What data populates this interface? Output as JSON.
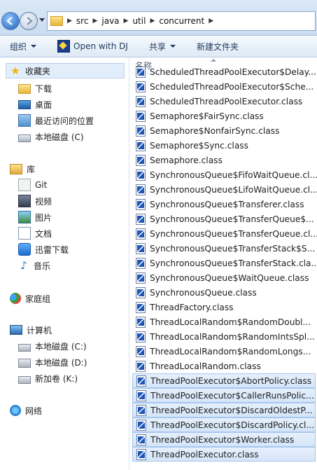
{
  "address": {
    "crumbs": [
      "src",
      "java",
      "util",
      "concurrent"
    ]
  },
  "toolbar": {
    "organize": "组织",
    "open_with": "Open with DJ",
    "share": "共享",
    "new_folder": "新建文件夹"
  },
  "nav": {
    "favorites": {
      "label": "收藏夹",
      "items": [
        "下载",
        "桌面",
        "最近访问的位置",
        "本地磁盘 (C)"
      ]
    },
    "libraries": {
      "label": "库",
      "items": [
        "Git",
        "视频",
        "图片",
        "文档",
        "迅雷下载",
        "音乐"
      ]
    },
    "homegroup": "家庭组",
    "computer": {
      "label": "计算机",
      "items": [
        "本地磁盘 (C:)",
        "本地磁盘 (D:)",
        "新加卷 (K:)"
      ]
    },
    "network": "网络"
  },
  "list": {
    "column_name": "名称",
    "files": [
      "ScheduledThreadPoolExecutor$Delay...",
      "ScheduledThreadPoolExecutor$Sche...",
      "ScheduledThreadPoolExecutor.class",
      "Semaphore$FairSync.class",
      "Semaphore$NonfairSync.class",
      "Semaphore$Sync.class",
      "Semaphore.class",
      "SynchronousQueue$FifoWaitQueue.cl...",
      "SynchronousQueue$LifoWaitQueue.cl...",
      "SynchronousQueue$Transferer.class",
      "SynchronousQueue$TransferQueue$...",
      "SynchronousQueue$TransferQueue.cl...",
      "SynchronousQueue$TransferStack$S...",
      "SynchronousQueue$TransferStack.cla...",
      "SynchronousQueue$WaitQueue.class",
      "SynchronousQueue.class",
      "ThreadFactory.class",
      "ThreadLocalRandom$RandomDoubl...",
      "ThreadLocalRandom$RandomIntsSpl...",
      "ThreadLocalRandom$RandomLongs...",
      "ThreadLocalRandom.class",
      "ThreadPoolExecutor$AbortPolicy.class",
      "ThreadPoolExecutor$CallerRunsPolic...",
      "ThreadPoolExecutor$DiscardOldestP...",
      "ThreadPoolExecutor$DiscardPolicy.cl...",
      "ThreadPoolExecutor$Worker.class",
      "ThreadPoolExecutor.class"
    ]
  }
}
